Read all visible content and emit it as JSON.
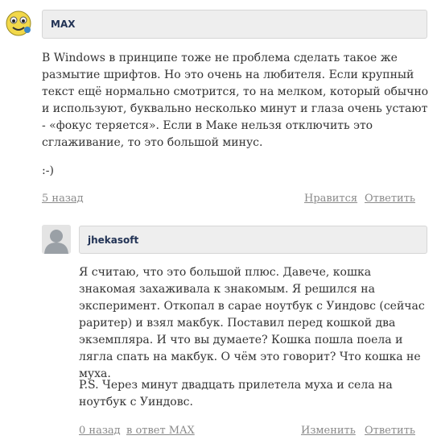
{
  "comment1": {
    "author": "MAX",
    "body": "В Windows в принципе тоже не проблема сделать такое же размытие шрифтов.  Но это очень на любителя. Если крупный текст ещё нормально смотрится, то на мелком, который обычно и используют, буквально несколько минут и глаза очень устают - «фокус теряется». Если в Маке нельзя отключить это сглаживание, то это большой минус.",
    "smiley": ":-)",
    "time": "5 назад",
    "like": "Нравится",
    "reply": "Ответить"
  },
  "comment2": {
    "author": "jhekasoft",
    "body": " Я считаю, что это большой плюс. Давече, кошка знакомая захаживала к знакомым. Я решился на эксперимент. Откопал в сарае ноутбук с Уиндовс (сейчас раритер) и взял макбук. Поставил перед кошкой два экземпляра. И что вы думаете? Кошка пошла поела и лягла спать на макбук. О чём это говорит? Что кошка не муха.",
    "ps": "P.S. Через минут двадцать прилетела муха и села на ноутбук с Уиндовс.",
    "time": "0 назад",
    "in_reply": "в ответ MAX",
    "edit": "Изменить",
    "reply": "Ответить"
  }
}
